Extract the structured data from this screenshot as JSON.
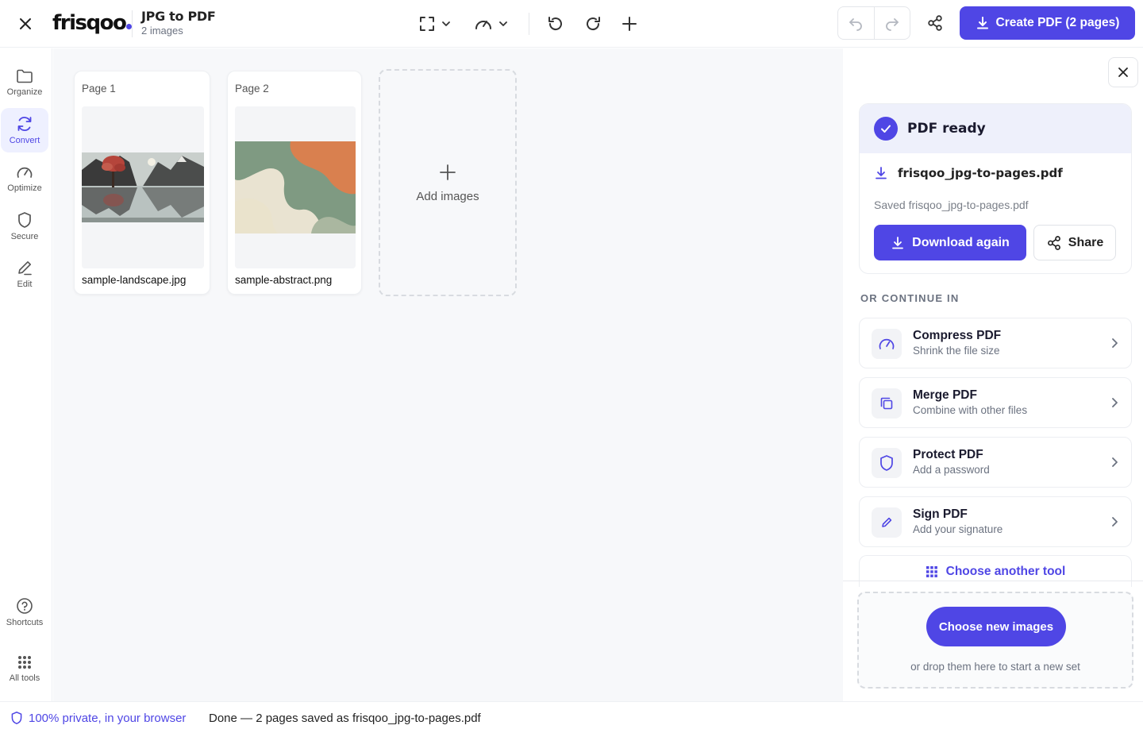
{
  "header": {
    "logo": "frisqoo",
    "title": "JPG to PDF",
    "subtitle": "2 images",
    "create_label": "Create PDF (2 pages)"
  },
  "rail": {
    "items": [
      {
        "label": "Organize",
        "icon": "folder-icon"
      },
      {
        "label": "Convert",
        "icon": "refresh-icon"
      },
      {
        "label": "Optimize",
        "icon": "gauge-icon"
      },
      {
        "label": "Secure",
        "icon": "shield-icon"
      },
      {
        "label": "Edit",
        "icon": "pencil-icon"
      }
    ],
    "bottom": [
      {
        "label": "Shortcuts",
        "icon": "help-circle-icon"
      },
      {
        "label": "All tools",
        "icon": "grid-icon"
      }
    ]
  },
  "pages": [
    {
      "label": "Page 1",
      "filename": "sample-landscape.jpg"
    },
    {
      "label": "Page 2",
      "filename": "sample-abstract.png"
    }
  ],
  "add_images_label": "Add images",
  "panel": {
    "ready_title": "PDF ready",
    "file_name": "frisqoo_jpg-to-pages.pdf",
    "saved_text": "Saved frisqoo_jpg-to-pages.pdf",
    "download_label": "Download again",
    "share_label": "Share",
    "continue_label": "OR CONTINUE IN",
    "tools": [
      {
        "title": "Compress PDF",
        "subtitle": "Shrink the file size",
        "icon": "gauge-icon"
      },
      {
        "title": "Merge PDF",
        "subtitle": "Combine with other files",
        "icon": "copy-icon"
      },
      {
        "title": "Protect PDF",
        "subtitle": "Add a password",
        "icon": "shield-icon"
      },
      {
        "title": "Sign PDF",
        "subtitle": "Add your signature",
        "icon": "pen-icon"
      }
    ],
    "another_tool_label": "Choose another tool",
    "choose_new_label": "Choose new images",
    "drop_text": "or drop them here to start a new set"
  },
  "status": {
    "private_label": "100% private, in your browser",
    "message": "Done — 2 pages saved as frisqoo_jpg-to-pages.pdf"
  },
  "colors": {
    "accent": "#4f46e5",
    "canvas_bg": "#f7f8fa"
  }
}
